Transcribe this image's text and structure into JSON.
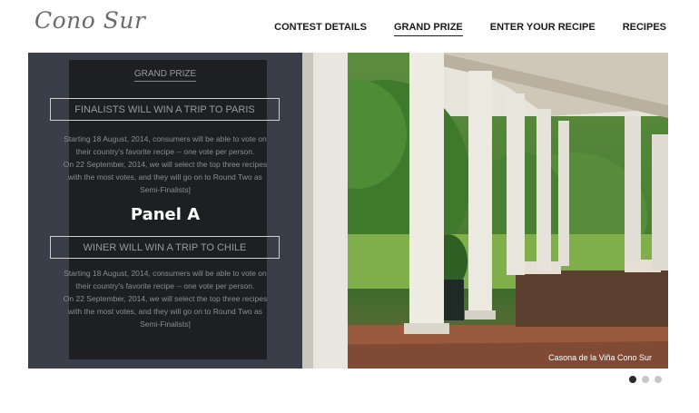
{
  "logo": {
    "text": "Cono Sur"
  },
  "nav": {
    "items": [
      {
        "label": "CONTEST DETAILS",
        "active": false
      },
      {
        "label": "GRAND PRIZE",
        "active": true
      },
      {
        "label": "ENTER YOUR RECIPE",
        "active": false
      },
      {
        "label": "RECIPES",
        "active": false
      }
    ]
  },
  "panel": {
    "section_label": "GRAND PRIZE",
    "box1_title": "FINALISTS WILL WIN A TRIP TO PARIS",
    "box1_p1": "Starting 18 August, 2014, consumers will be able to vote on their country's favorite recipe -- one vote per person.",
    "box1_p2": "On 22 September, 2014, we will select the top three recipes with the most votes, and they will go on to Round Two as Semi-Finalists]",
    "panel_label": "Panel A",
    "box2_title": "WINER WILL WIN A TRIP TO CHILE",
    "box2_p1": "Starting 18 August, 2014, consumers will be able to vote on their country's favorite recipe -- one vote per person.",
    "box2_p2": "On 22 September, 2014, we will select the top three recipes with the most votes, and they will go on to Round Two as Semi-Finalists]"
  },
  "photo": {
    "caption": "Casona de la Viña Cono Sur"
  },
  "carousel": {
    "active_index": 0,
    "count": 3
  }
}
